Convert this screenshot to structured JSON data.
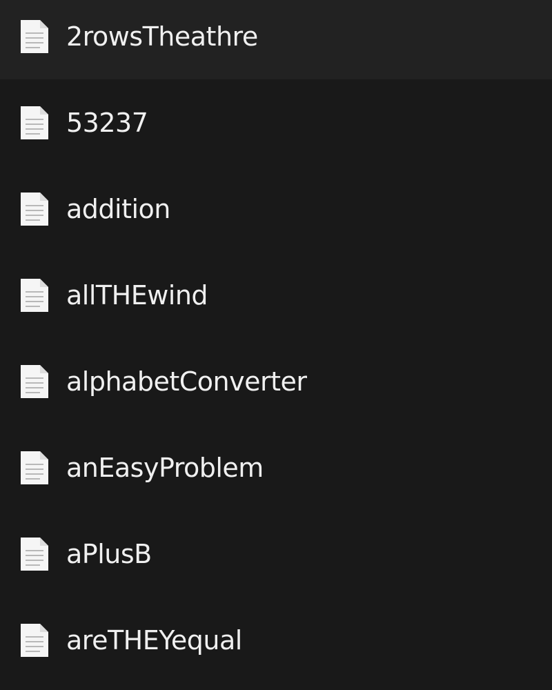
{
  "colors": {
    "background": "#191919",
    "text": "#f0f0f0",
    "icon_page": "#f5f5f5",
    "icon_lines": "#b8b8b8"
  },
  "file_icon": "text-document-icon",
  "files": [
    {
      "name": "2rowsTheathre"
    },
    {
      "name": "53237"
    },
    {
      "name": "addition"
    },
    {
      "name": "allTHEwind"
    },
    {
      "name": "alphabetConverter"
    },
    {
      "name": "anEasyProblem"
    },
    {
      "name": "aPlusB"
    },
    {
      "name": "areTHEYequal"
    }
  ]
}
